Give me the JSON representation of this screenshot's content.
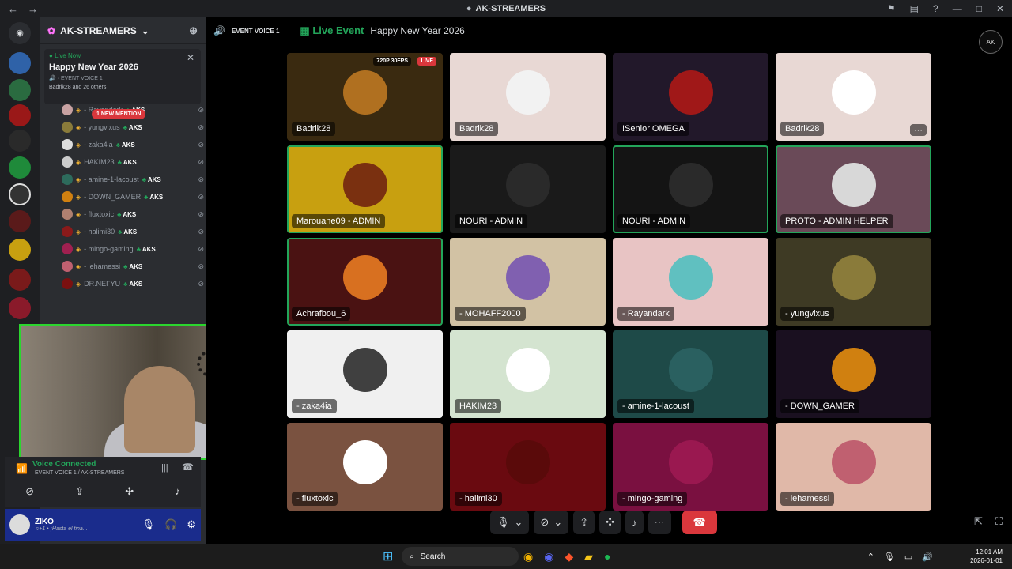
{
  "window": {
    "title": "AK-STREAMERS",
    "nav_back": "←",
    "nav_forward": "→"
  },
  "server": {
    "name": "AK-STREAMERS",
    "event": {
      "status": "Live Now",
      "name": "Happy New Year 2026",
      "channel": "EVENT VOICE 1",
      "attendees": "Badrik28 and 26 others"
    }
  },
  "members": {
    "new_mention": "1 NEW MENTION",
    "list": [
      {
        "name": "- Rayandark",
        "tag": "AKS",
        "color": "#c8a2a2"
      },
      {
        "name": "- yungvixus",
        "tag": "AKS",
        "color": "#8a7b3a"
      },
      {
        "name": "- zaka4ia",
        "tag": "AKS",
        "color": "#ddd"
      },
      {
        "name": "HAKIM23",
        "tag": "AKS",
        "color": "#ccc"
      },
      {
        "name": "- amine-1-lacoust",
        "tag": "AKS",
        "color": "#2d6b5c"
      },
      {
        "name": "- DOWN_GAMER",
        "tag": "AKS",
        "color": "#d08010"
      },
      {
        "name": "- fluxtoxic",
        "tag": "AKS",
        "color": "#b08070"
      },
      {
        "name": "- halimi30",
        "tag": "AKS",
        "color": "#8a1a1a"
      },
      {
        "name": "- mingo-gaming",
        "tag": "AKS",
        "color": "#a02050"
      },
      {
        "name": "- lehamessi",
        "tag": "AKS",
        "color": "#c06070"
      },
      {
        "name": "DR.NEFYU",
        "tag": "AKS",
        "color": "#7a1010"
      }
    ]
  },
  "voice": {
    "status": "Voice Connected",
    "channel": "EVENT VOICE 1 / AK-STREAMERS"
  },
  "user": {
    "name": "ZIKO",
    "status": "♫+1 • ¡Hasta el fina..."
  },
  "stage": {
    "channel": "EVENT VOICE 1",
    "live_event": "Live Event",
    "event_name": "Happy New Year 2026",
    "tiles": [
      {
        "label": "Badrik28",
        "bg": "#3a2a10",
        "pic": "#b07020",
        "quality": "720P 30FPS",
        "live": "LIVE",
        "speaking": false
      },
      {
        "label": "Badrik28",
        "bg": "#e8d8d4",
        "pic": "#f2f2f2",
        "speaking": false
      },
      {
        "label": "!Senior OMEGA",
        "bg": "#22182a",
        "pic": "#a01818",
        "speaking": false
      },
      {
        "label": "Badrik28",
        "bg": "#e8d8d4",
        "pic": "#ffffff",
        "speaking": false
      },
      {
        "label": "Marouane09 - ADMIN",
        "bg": "#c8a010",
        "pic": "#7a3010",
        "speaking": true
      },
      {
        "label": "NOURI - ADMIN",
        "bg": "#1a1a1a",
        "pic": "#2a2a2a",
        "speaking": false
      },
      {
        "label": "NOURI - ADMIN",
        "bg": "#141414",
        "pic": "#2a2a2a",
        "speaking": true
      },
      {
        "label": "PROTO - ADMIN HELPER",
        "bg": "#6a4a58",
        "pic": "#d8d8d8",
        "speaking": true
      },
      {
        "label": "Achrafbou_6",
        "bg": "#4a1212",
        "pic": "#d87020",
        "speaking": true
      },
      {
        "label": "- MOHAFF2000",
        "bg": "#d2c2a4",
        "pic": "#8060b0",
        "speaking": false
      },
      {
        "label": "- Rayandark",
        "bg": "#e8c4c4",
        "pic": "#60c0c0",
        "speaking": false
      },
      {
        "label": "- yungvixus",
        "bg": "#3e3a24",
        "pic": "#8a7b3a",
        "speaking": false
      },
      {
        "label": "- zaka4ia",
        "bg": "#f0f0f0",
        "pic": "#404040",
        "speaking": false
      },
      {
        "label": "HAKIM23",
        "bg": "#d4e4d0",
        "pic": "#ffffff",
        "speaking": false
      },
      {
        "label": "- amine-1-lacoust",
        "bg": "#1e4a48",
        "pic": "#2a6060",
        "speaking": false
      },
      {
        "label": "- DOWN_GAMER",
        "bg": "#1a1020",
        "pic": "#d08010",
        "speaking": false
      },
      {
        "label": "- fluxtoxic",
        "bg": "#7a5240",
        "pic": "#ffffff",
        "speaking": false
      },
      {
        "label": "- halimi30",
        "bg": "#6a0a10",
        "pic": "#5a0a0a",
        "speaking": false
      },
      {
        "label": "- mingo-gaming",
        "bg": "#7a1040",
        "pic": "#9a1850",
        "speaking": false
      },
      {
        "label": "- lehamessi",
        "bg": "#e0b8a8",
        "pic": "#c06070",
        "speaking": false
      }
    ]
  },
  "taskbar": {
    "search": "Search",
    "time": "12:01 AM",
    "date": "2026-01-01"
  },
  "colors": {
    "green": "#23a55a",
    "red": "#da373c",
    "blurple": "#5865f2"
  }
}
